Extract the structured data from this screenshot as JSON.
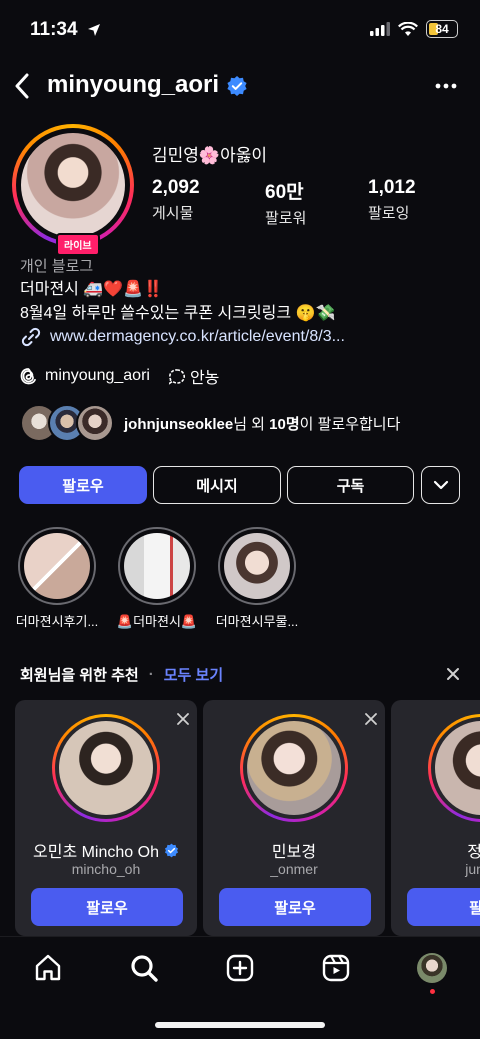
{
  "status": {
    "time": "11:34",
    "battery": "84"
  },
  "header": {
    "username": "minyoung_aori"
  },
  "profile": {
    "display_name": "김민영🌸아옳이",
    "live_label": "라이브",
    "stats": [
      {
        "value": "2,092",
        "label": "게시물"
      },
      {
        "value": "60만",
        "label": "팔로워"
      },
      {
        "value": "1,012",
        "label": "팔로잉"
      }
    ],
    "category": "개인 블로그",
    "bio_line1": "더마젼시 🚑❤️🚨‼️",
    "bio_line2": "8월4일 하루만 쓸수있는 쿠폰 시크릿링크 🤫💸",
    "link": "www.dermagency.co.kr/article/event/8/3...",
    "threads_handle": "minyoung_aori",
    "threads_badge": "안농",
    "mutual_user": "johnjunseoklee",
    "mutual_mid": "님 외 ",
    "mutual_count": "10명",
    "mutual_end": "이 팔로우합니다"
  },
  "actions": {
    "follow": "팔로우",
    "message": "메시지",
    "subscribe": "구독"
  },
  "highlights": [
    {
      "label": "더마젼시후기..."
    },
    {
      "label": "🚨더마젼시🚨"
    },
    {
      "label": "더마젼시무물..."
    }
  ],
  "suggestions": {
    "title": "회원님을 위한 추천",
    "separator": "·",
    "see_all": "모두 보기",
    "cards": [
      {
        "name": "오민초 Mincho Oh",
        "handle": "mincho_oh",
        "button": "팔로우"
      },
      {
        "name": "민보경",
        "handle": "_onmer",
        "button": "팔로우"
      },
      {
        "name": "정상",
        "handle": "jungs",
        "button": "팔로"
      }
    ]
  },
  "colors": {
    "accent": "#4a5cf0",
    "link": "#6b84ff",
    "live": "#ff1f6a",
    "verified": "#3d8bff"
  }
}
